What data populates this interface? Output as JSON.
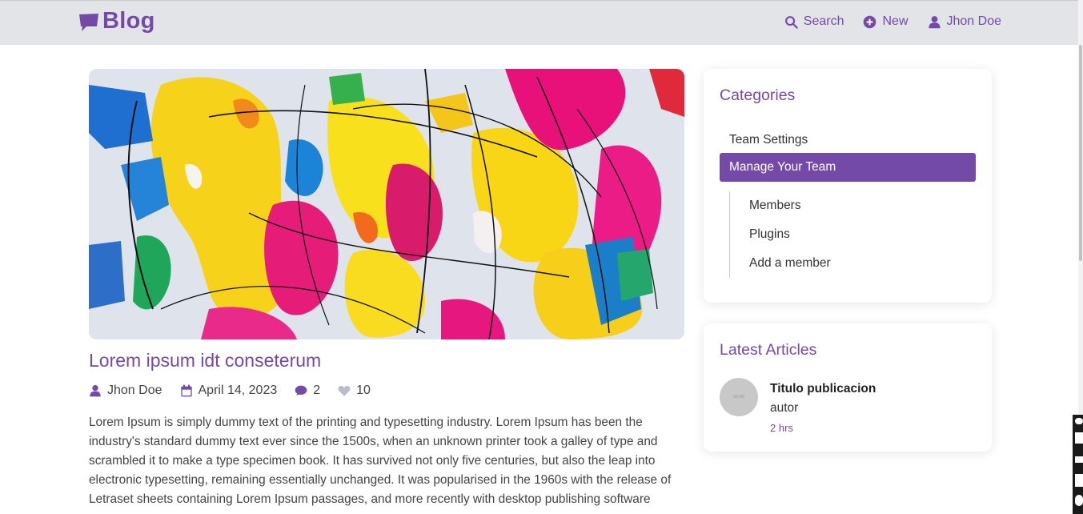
{
  "navbar": {
    "brand": "Blog",
    "links": [
      {
        "label": "Search",
        "icon": "search-icon"
      },
      {
        "label": "New",
        "icon": "plus-circle-icon"
      },
      {
        "label": "Jhon Doe",
        "icon": "user-icon"
      }
    ]
  },
  "post": {
    "title": "Lorem ipsum idt conseterum",
    "author": "Jhon Doe",
    "date": "April 14, 2023",
    "comments": "2",
    "likes": "10",
    "body": "Lorem Ipsum is simply dummy text of the printing and typesetting industry. Lorem Ipsum has been the industry's standard dummy text ever since the 1500s, when an unknown printer took a galley of type and scrambled it to make a type specimen book. It has survived not only five centuries, but also the leap into electronic typesetting, remaining essentially unchanged. It was popularised in the 1960s with the release of Letraset sheets containing Lorem Ipsum passages, and more recently with desktop publishing software"
  },
  "categories": {
    "title": "Categories",
    "items": [
      {
        "label": "Team Settings"
      },
      {
        "label": "Manage Your Team",
        "active": true
      }
    ],
    "subitems": [
      {
        "label": "Members"
      },
      {
        "label": "Plugins"
      },
      {
        "label": "Add a member"
      }
    ]
  },
  "latest": {
    "title": "Latest Articles",
    "article": {
      "avatar_text": "96×96",
      "title": "Titulo publicacion",
      "author": "autor",
      "time": "2 hrs"
    }
  },
  "colors": {
    "accent": "#744aa8",
    "navbar_bg": "#e2e4e8"
  }
}
